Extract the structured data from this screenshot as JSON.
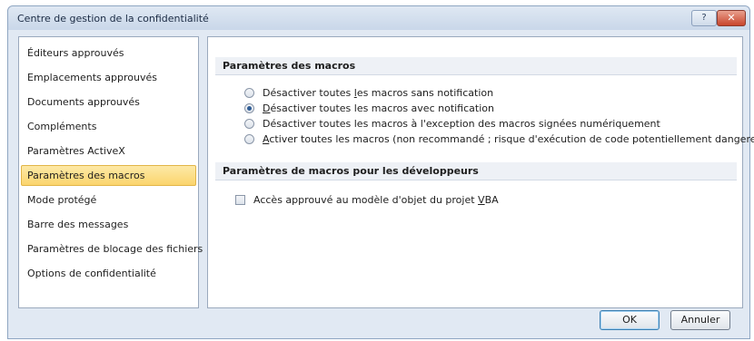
{
  "window": {
    "title": "Centre de gestion de la confidentialité",
    "help_label": "?",
    "close_label": "✕"
  },
  "sidebar": {
    "items": [
      {
        "label": "Éditeurs approuvés"
      },
      {
        "label": "Emplacements approuvés"
      },
      {
        "label": "Documents approuvés"
      },
      {
        "label": "Compléments"
      },
      {
        "label": "Paramètres ActiveX"
      },
      {
        "label": "Paramètres des macros",
        "selected": true
      },
      {
        "label": "Mode protégé"
      },
      {
        "label": "Barre des messages"
      },
      {
        "label": "Paramètres de blocage des fichiers"
      },
      {
        "label": "Options de confidentialité"
      }
    ]
  },
  "macro_settings": {
    "header": "Paramètres des macros",
    "options": [
      {
        "pre": "Désactiver toutes ",
        "key": "l",
        "post": "es macros sans notification",
        "checked": false
      },
      {
        "pre": "",
        "key": "D",
        "post": "ésactiver toutes les macros avec notification",
        "checked": true
      },
      {
        "pre": "Désactiver toutes les macros à l'exception des macros signées numériquement",
        "key": "",
        "post": "",
        "checked": false
      },
      {
        "pre": "",
        "key": "A",
        "post": "ctiver toutes les macros (non recommandé ; risque d'exécution de code potentiellement dangereux)",
        "checked": false
      }
    ]
  },
  "developer_settings": {
    "header": "Paramètres de macros pour les développeurs",
    "vba_access": {
      "pre": "Accès approuvé au modèle d'objet du projet ",
      "key": "V",
      "post": "BA",
      "checked": false
    }
  },
  "buttons": {
    "ok": "OK",
    "cancel": "Annuler"
  }
}
